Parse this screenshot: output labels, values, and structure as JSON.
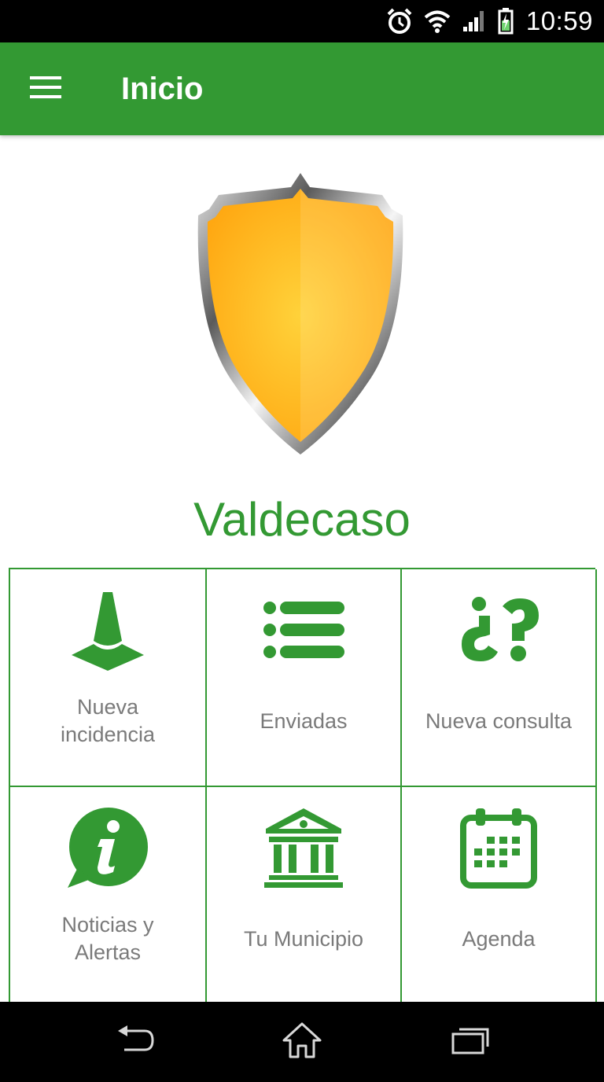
{
  "status_bar": {
    "time": "10:59",
    "icons": [
      "alarm-icon",
      "wifi-icon",
      "signal-icon",
      "battery-charging-icon"
    ]
  },
  "app_bar": {
    "title": "Inicio",
    "menu_icon": "hamburger-menu-icon"
  },
  "crest": {
    "icon": "shield-crest"
  },
  "town_name": "Valdecaso",
  "grid": {
    "items": [
      {
        "label": "Nueva\nincidencia",
        "icon": "traffic-cone-icon"
      },
      {
        "label": "Enviadas",
        "icon": "list-icon"
      },
      {
        "label": "Nueva consulta",
        "icon": "question-marks-icon"
      },
      {
        "label": "Noticias y\nAlertas",
        "icon": "info-bubble-icon"
      },
      {
        "label": "Tu Municipio",
        "icon": "town-hall-icon"
      },
      {
        "label": "Agenda",
        "icon": "calendar-icon"
      }
    ]
  },
  "nav_bar": {
    "icons": [
      "back-icon",
      "home-icon",
      "recent-apps-icon"
    ]
  },
  "colors": {
    "primary": "#339933",
    "label": "#7a7a7a",
    "shield": "#ffb21e"
  }
}
